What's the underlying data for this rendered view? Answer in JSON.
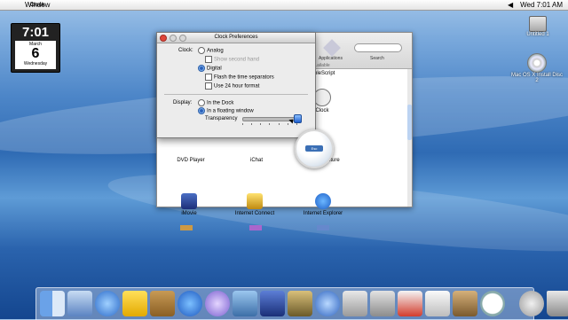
{
  "menubar": {
    "app_name": "Clock",
    "items": [
      "Window"
    ],
    "clock": "Wed 7:01 AM"
  },
  "clock_widget": {
    "time": "7:01",
    "month": "March",
    "day": "6",
    "weekday": "Wednesday"
  },
  "desktop": {
    "icons": [
      {
        "label": "Untitled 1",
        "icon": "hard-disk-icon"
      },
      {
        "label": "Mac OS X Install Disc 2",
        "icon": "cd-icon"
      }
    ]
  },
  "finder": {
    "toolbar": [
      "Applications",
      "Search"
    ],
    "partial_labels": [
      "...ailable",
      "...pleScript"
    ],
    "apps": [
      {
        "label": "Clock",
        "icon": "clock-icon"
      },
      {
        "label": "DVD Player",
        "icon": "dvd-icon"
      },
      {
        "label": "iChat",
        "icon": "ichat-icon"
      },
      {
        "label": "...ture",
        "icon": "capture-icon"
      },
      {
        "label": "iMovie",
        "icon": "imovie-icon"
      },
      {
        "label": "Internet Connect",
        "icon": "internet-connect-icon"
      },
      {
        "label": "Internet Explorer",
        "icon": "ie-icon"
      }
    ]
  },
  "prefs": {
    "title": "Clock Preferences",
    "clock_label": "Clock:",
    "analog": "Analog",
    "show_second_hand": "Show second hand",
    "digital": "Digital",
    "flash_separators": "Flash the time separators",
    "use_24h": "Use 24 hour format",
    "display_label": "Display:",
    "in_dock": "In the Dock",
    "floating": "In a floating window",
    "transparency": "Transparency",
    "transparency_level": 1.0
  },
  "floating_clock": {
    "label": "Esc"
  },
  "dock": {
    "icons": [
      "finder-icon",
      "mail-icon",
      "ichat-icon",
      "aim-icon",
      "address-book-icon",
      "internet-explorer-icon",
      "itunes-icon",
      "iphoto-icon",
      "imovie-icon",
      "sherlock-icon",
      "quicktime-icon",
      "system-preferences-icon",
      "ichat-av-icon",
      "acrobat-icon",
      "textedit-icon",
      "preview-icon",
      "clock-icon",
      "mail-at-icon",
      "trash-icon"
    ]
  }
}
